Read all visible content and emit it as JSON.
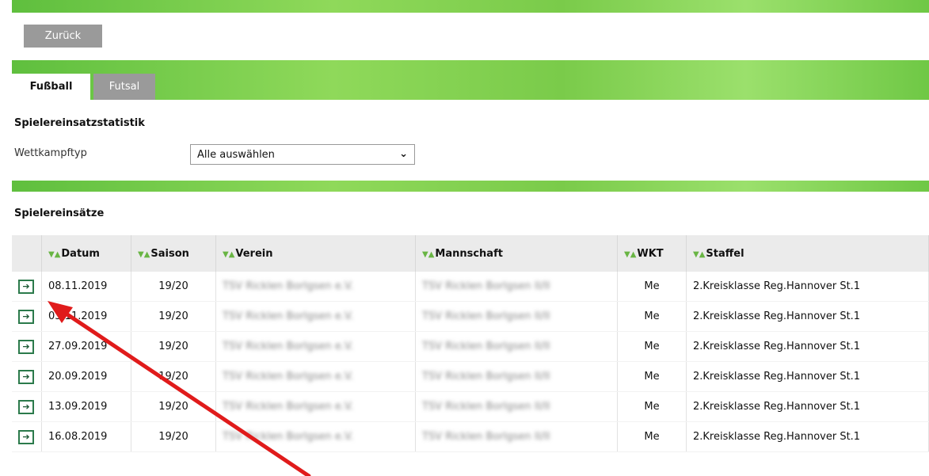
{
  "toolbar": {
    "back_label": "Zurück"
  },
  "tabs": [
    {
      "label": "Fußball"
    },
    {
      "label": "Futsal"
    }
  ],
  "stats": {
    "heading": "Spielereinsatzstatistik",
    "filter_label": "Wettkampftyp",
    "filter_value": "Alle auswählen"
  },
  "einsaetze": {
    "heading": "Spielereinsätze",
    "sort_icon": "▼▲",
    "columns": [
      "Datum",
      "Saison",
      "Verein",
      "Mannschaft",
      "WKT",
      "Staffel"
    ],
    "rows": [
      {
        "datum": "08.11.2019",
        "saison": "19/20",
        "verein": "TSV Ricklen Borlgsen e.V.",
        "mannschaft": "TSV Ricklen Borlgsen II/II",
        "wkt": "Me",
        "staffel": "2.Kreisklasse Reg.Hannover St.1"
      },
      {
        "datum": "03.11.2019",
        "saison": "19/20",
        "verein": "TSV Ricklen Borlgsen e.V.",
        "mannschaft": "TSV Ricklen Borlgsen II/II",
        "wkt": "Me",
        "staffel": "2.Kreisklasse Reg.Hannover St.1"
      },
      {
        "datum": "27.09.2019",
        "saison": "19/20",
        "verein": "TSV Ricklen Borlgsen e.V.",
        "mannschaft": "TSV Ricklen Borlgsen II/II",
        "wkt": "Me",
        "staffel": "2.Kreisklasse Reg.Hannover St.1"
      },
      {
        "datum": "20.09.2019",
        "saison": "19/20",
        "verein": "TSV Ricklen Borlgsen e.V.",
        "mannschaft": "TSV Ricklen Borlgsen II/II",
        "wkt": "Me",
        "staffel": "2.Kreisklasse Reg.Hannover St.1"
      },
      {
        "datum": "13.09.2019",
        "saison": "19/20",
        "verein": "TSV Ricklen Borlgsen e.V.",
        "mannschaft": "TSV Ricklen Borlgsen II/II",
        "wkt": "Me",
        "staffel": "2.Kreisklasse Reg.Hannover St.1"
      },
      {
        "datum": "16.08.2019",
        "saison": "19/20",
        "verein": "TSV Ricklen Borlgsen e.V.",
        "mannschaft": "TSV Ricklen Borlgsen II/II",
        "wkt": "Me",
        "staffel": "2.Kreisklasse Reg.Hannover St.1"
      }
    ]
  },
  "icons": {
    "row_button": "arrow-right-icon",
    "annotation": "red-arrow-annotation"
  },
  "colors": {
    "accent_green": "#7acb4a",
    "tab_gray": "#9a9a9a",
    "button_border": "#2b7a4b",
    "annotation_red": "#e01b1b"
  }
}
